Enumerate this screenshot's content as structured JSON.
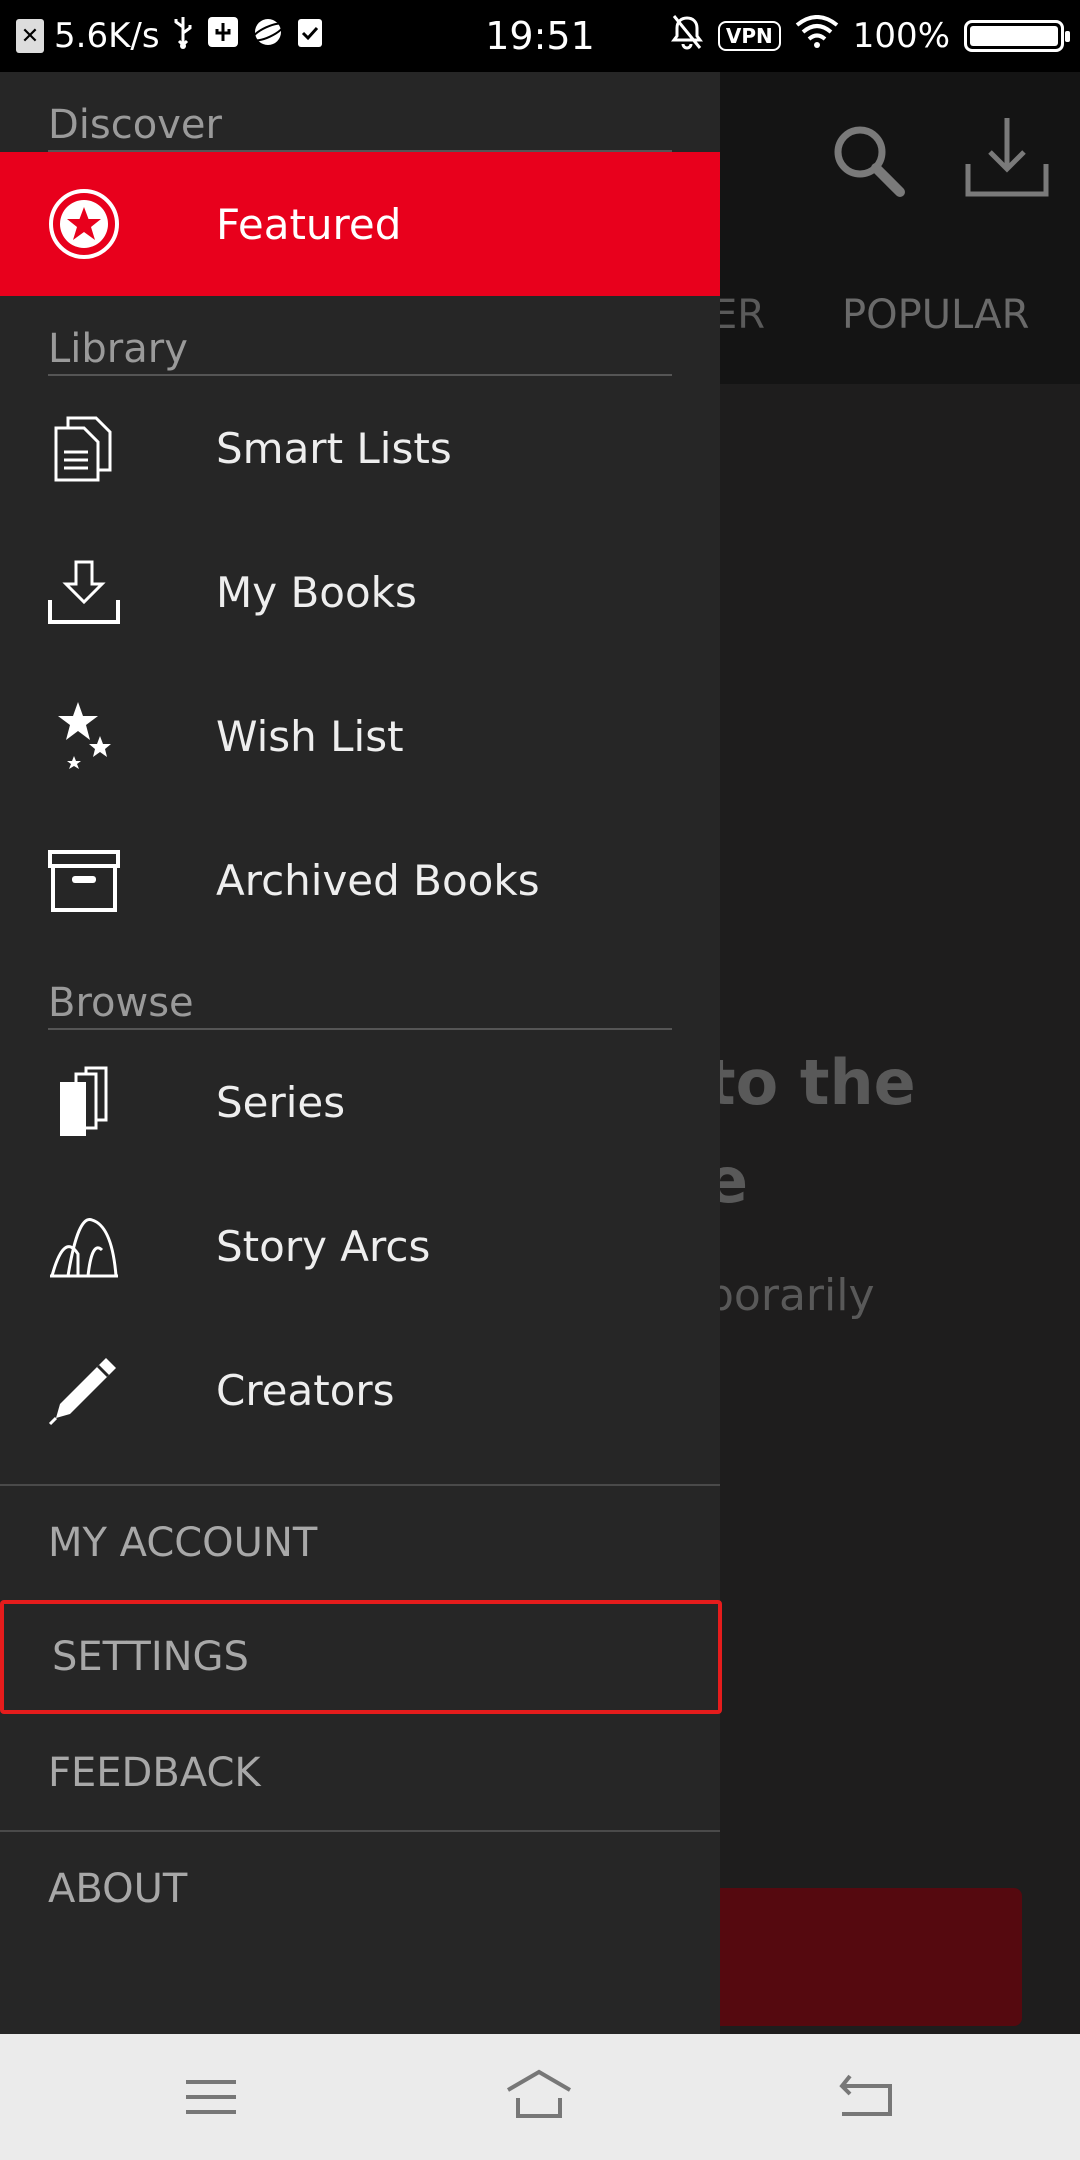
{
  "status_bar": {
    "speed": "5.6K/s",
    "time": "19:51",
    "vpn_label": "VPN",
    "battery": "100%"
  },
  "background": {
    "tab_partial": "ER",
    "tab_popular": "POPULAR",
    "text_line1": "to the",
    "text_line2": "e",
    "text_line3": "porarily"
  },
  "drawer": {
    "sections": {
      "discover": "Discover",
      "library": "Library",
      "browse": "Browse"
    },
    "items": {
      "featured": "Featured",
      "smart_lists": "Smart Lists",
      "my_books": "My Books",
      "wish_list": "Wish List",
      "archived_books": "Archived Books",
      "series": "Series",
      "story_arcs": "Story Arcs",
      "creators": "Creators"
    },
    "menu": {
      "my_account": "MY ACCOUNT",
      "settings": "SETTINGS",
      "feedback": "FEEDBACK",
      "about": "ABOUT"
    }
  },
  "colors": {
    "accent": "#e8001c",
    "drawer_bg": "#262626",
    "highlight_border": "#e51c1c"
  }
}
